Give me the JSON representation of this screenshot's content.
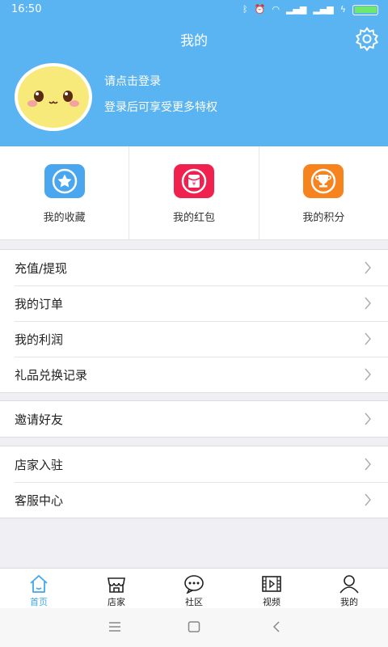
{
  "status": {
    "time": "16:50"
  },
  "header": {
    "title": "我的"
  },
  "profile": {
    "login_prompt": "请点击登录",
    "login_hint": "登录后可享受更多特权"
  },
  "quick_actions": [
    {
      "label": "我的收藏",
      "icon": "star-icon",
      "color": "#4aa6ee"
    },
    {
      "label": "我的红包",
      "icon": "red-packet-icon",
      "color": "#f0214f"
    },
    {
      "label": "我的积分",
      "icon": "trophy-icon",
      "color": "#f6831e"
    }
  ],
  "menu": {
    "group1": [
      "充值/提现",
      "我的订单",
      "我的利润",
      "礼品兑换记录"
    ],
    "group2": [
      "邀请好友"
    ],
    "group3": [
      "店家入驻",
      "客服中心"
    ]
  },
  "tabs": [
    {
      "label": "首页",
      "icon": "home-icon",
      "active": true
    },
    {
      "label": "店家",
      "icon": "store-icon"
    },
    {
      "label": "社区",
      "icon": "chat-icon"
    },
    {
      "label": "视频",
      "icon": "video-icon"
    },
    {
      "label": "我的",
      "icon": "profile-icon"
    }
  ],
  "colors": {
    "header": "#5ab4f2",
    "accent": "#3fa7ec",
    "background": "#efeff4"
  }
}
